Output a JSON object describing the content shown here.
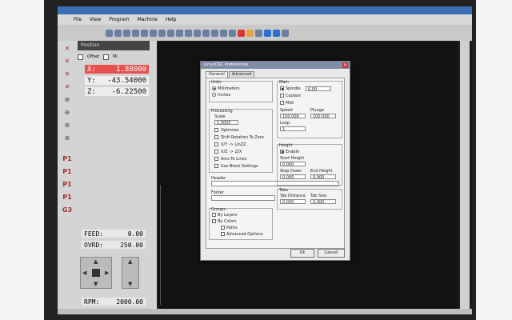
{
  "menu": {
    "items": [
      "File",
      "View",
      "Program",
      "Machine",
      "Help"
    ]
  },
  "left": {
    "panel_title": "Position",
    "check_labels": [
      "Offset",
      "Mi"
    ],
    "dro": [
      {
        "axis": "X:",
        "value": "1.88000"
      },
      {
        "axis": "Y:",
        "value": "-43.54000"
      },
      {
        "axis": "Z:",
        "value": "-6.22500"
      }
    ],
    "feed": {
      "label": "FEED:",
      "value": "0.00"
    },
    "ovrd": {
      "label": "OVRD:",
      "value": "250.00"
    },
    "rpm": {
      "label": "RPM:",
      "value": "2000.00"
    }
  },
  "dialog": {
    "title": "LinuxCNC Preferences",
    "tabs": [
      "General",
      "Advanced"
    ],
    "units": {
      "title": "Units",
      "options": [
        "Millimeters",
        "Inches"
      ]
    },
    "processing": {
      "title": "Processing",
      "scale_label": "Scale",
      "scale_value": "1.0000",
      "options": [
        "Optimize",
        "Shift Rotation To Zero",
        "X/Y -> LinZZ",
        "X/Z -> Z/X",
        "Arcs To Lines",
        "Use Block Settings"
      ]
    },
    "header": "Header",
    "footer": "Footer",
    "groups": {
      "title": "Groups",
      "options": [
        "By Layers",
        "By Colors"
      ],
      "sub": [
        "Paths",
        "Advanced Options"
      ]
    },
    "main": {
      "title": "Main",
      "spindle_label": "Spindle",
      "spindle_value": "0.00",
      "coolant": "Coolant",
      "mist": "Mist",
      "speed_label": "Speed",
      "speed_value": "100.000",
      "plunge_label": "Plunge",
      "plunge_value": "100.000",
      "loop_label": "Loop",
      "loop_value": "1"
    },
    "height": {
      "title": "Height",
      "enable": "Enable",
      "start_label": "Start Height",
      "start_value": "0.000",
      "step_label": "Step Down",
      "step_value": "0.000",
      "end_label": "End Height",
      "end_value": "0.000"
    },
    "tabs_group": {
      "title": "Tabs",
      "distance_label": "Tab Distance",
      "distance_value": "0.000",
      "size_label": "Tab Size",
      "size_value": "0.000"
    },
    "ok": "Ok",
    "cancel": "Cancel"
  },
  "colors": {
    "accent": "#e85050",
    "title": "#3c6fb6"
  }
}
